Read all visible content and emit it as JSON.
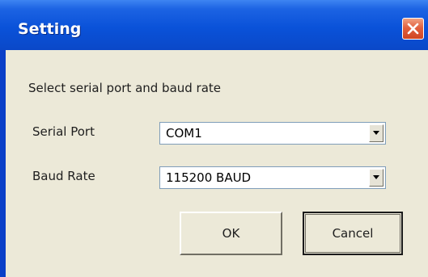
{
  "window": {
    "title": "Setting"
  },
  "titlebar": {
    "close_icon": "close-icon"
  },
  "dialog": {
    "prompt": "Select serial port and baud rate",
    "serial_port": {
      "label": "Serial Port",
      "value": "COM1",
      "icon": "chevron-down-icon"
    },
    "baud_rate": {
      "label": "Baud Rate",
      "value": "115200 BAUD",
      "icon": "chevron-down-icon"
    },
    "buttons": {
      "ok": "OK",
      "cancel": "Cancel"
    }
  },
  "colors": {
    "titlebar": "#0a52d9",
    "client_background": "#ece9d8",
    "close_button": "#e2613f",
    "input_border": "#7f9db9"
  }
}
